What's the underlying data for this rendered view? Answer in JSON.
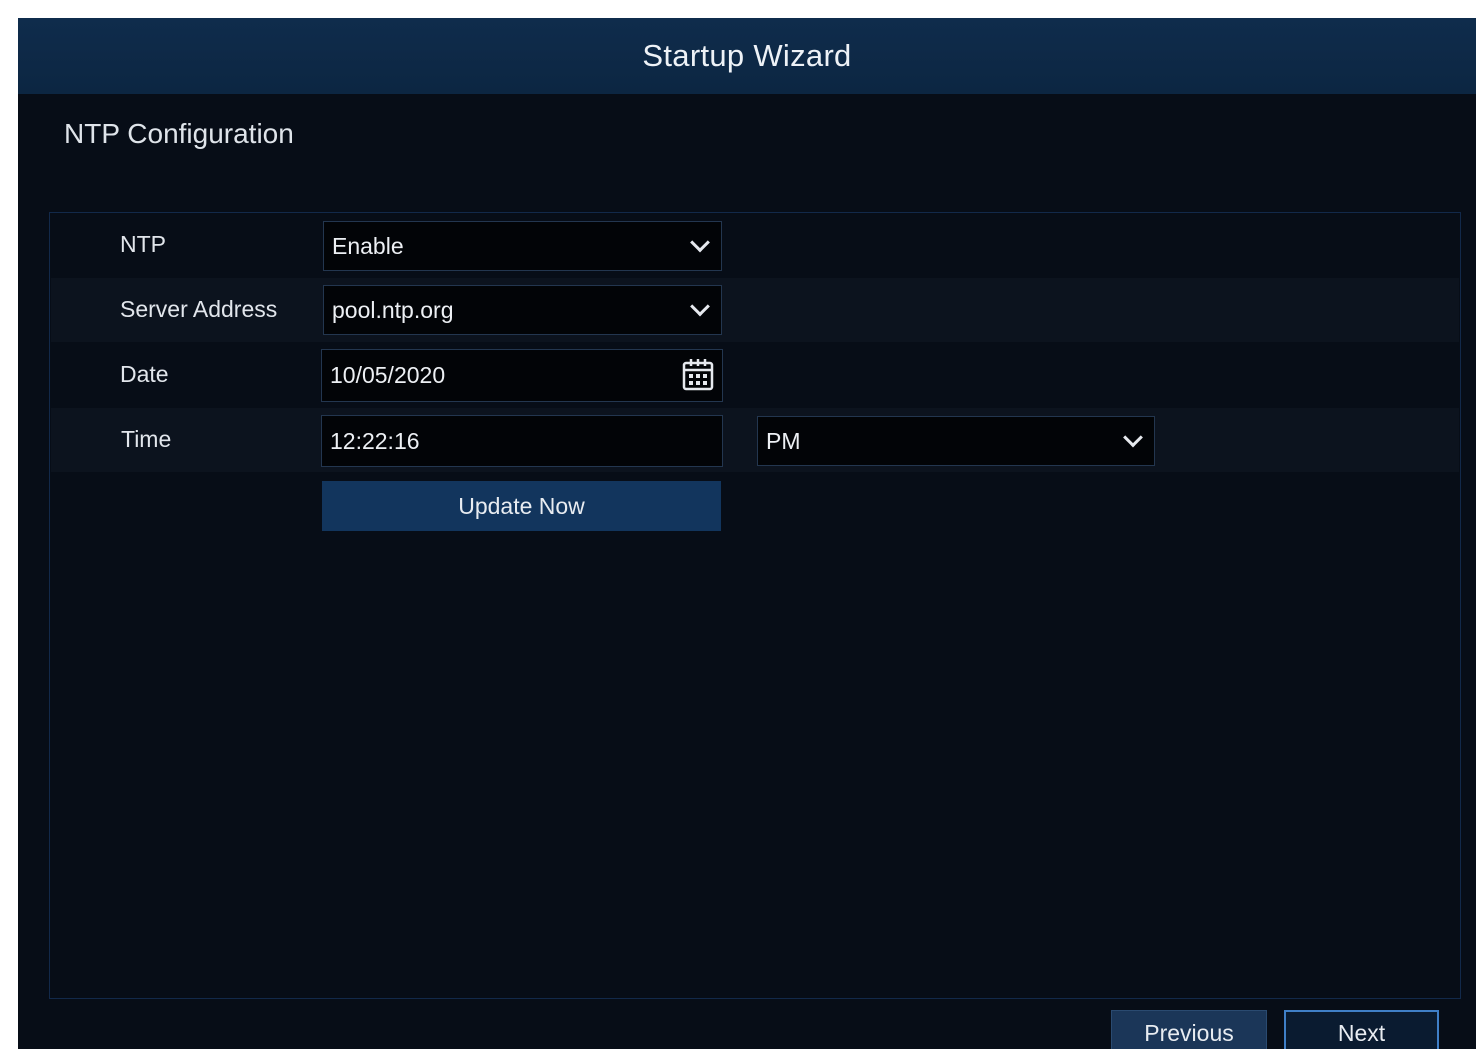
{
  "window": {
    "title": "Startup Wizard"
  },
  "section": {
    "title": "NTP Configuration"
  },
  "form": {
    "ntp": {
      "label": "NTP",
      "value": "Enable"
    },
    "server": {
      "label": "Server Address",
      "value": "pool.ntp.org"
    },
    "date": {
      "label": "Date",
      "value": "10/05/2020"
    },
    "time": {
      "label": "Time",
      "value": "12:22:16",
      "ampm": "PM"
    },
    "update_label": "Update Now"
  },
  "footer": {
    "previous_label": "Previous",
    "next_label": "Next"
  },
  "icons": {
    "dropdown": "chevron-down-icon",
    "calendar": "calendar-icon"
  },
  "colors": {
    "background": "#070d17",
    "titlebar": "#0f2c4c",
    "accent": "#3f7fc7"
  }
}
